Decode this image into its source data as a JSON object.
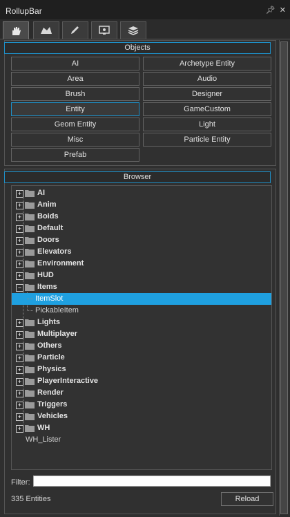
{
  "window": {
    "title": "RollupBar"
  },
  "tabs": [
    {
      "icon": "hand-icon",
      "active": true
    },
    {
      "icon": "terrain-icon",
      "active": false
    },
    {
      "icon": "pencil-icon",
      "active": false
    },
    {
      "icon": "monitor-icon",
      "active": false
    },
    {
      "icon": "layers-icon",
      "active": false
    }
  ],
  "objects": {
    "header": "Objects",
    "buttons": [
      {
        "label": "AI"
      },
      {
        "label": "Archetype Entity"
      },
      {
        "label": "Area"
      },
      {
        "label": "Audio"
      },
      {
        "label": "Brush"
      },
      {
        "label": "Designer"
      },
      {
        "label": "Entity",
        "selected": true
      },
      {
        "label": "GameCustom"
      },
      {
        "label": "Geom Entity"
      },
      {
        "label": "Light"
      },
      {
        "label": "Misc"
      },
      {
        "label": "Particle Entity"
      },
      {
        "label": "Prefab"
      }
    ]
  },
  "browser": {
    "header": "Browser",
    "folders": [
      "AI",
      "Anim",
      "Boids",
      "Default",
      "Doors",
      "Elevators",
      "Environment",
      "HUD",
      "Items",
      "Lights",
      "Multiplayer",
      "Others",
      "Particle",
      "Physics",
      "PlayerInteractive",
      "Render",
      "Triggers",
      "Vehicles",
      "WH"
    ],
    "items_children": [
      "ItemSlot",
      "PickableItem"
    ],
    "selected": "ItemSlot",
    "lister": "WH_Lister"
  },
  "filter": {
    "label": "Filter:",
    "value": ""
  },
  "status": {
    "entity_count": "335 Entities",
    "reload_label": "Reload"
  },
  "colors": {
    "accent": "#1fa0e0",
    "background": "#2f2f2f"
  }
}
